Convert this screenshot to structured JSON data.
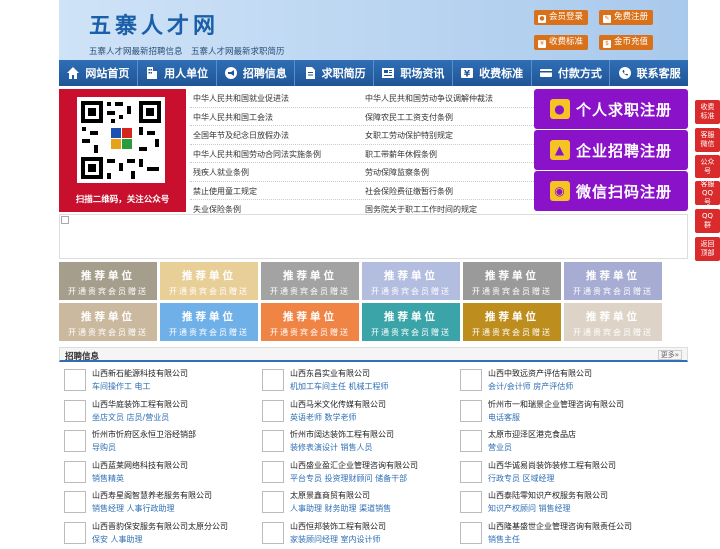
{
  "site": {
    "logo": "五寨人才网",
    "slogan": "五寨人才网最新招聘信息　五寨人才网最新求职简历"
  },
  "header_buttons": [
    {
      "label": "会员登录",
      "icon": "user-icon"
    },
    {
      "label": "免费注册",
      "icon": "edit-icon"
    },
    {
      "label": "收费标准",
      "icon": "tag-icon"
    },
    {
      "label": "金币充值",
      "icon": "coin-icon"
    }
  ],
  "nav": [
    {
      "label": "网站首页",
      "icon": "home-icon"
    },
    {
      "label": "用人单位",
      "icon": "building-icon"
    },
    {
      "label": "招聘信息",
      "icon": "megaphone-icon"
    },
    {
      "label": "求职简历",
      "icon": "document-icon"
    },
    {
      "label": "职场资讯",
      "icon": "news-icon"
    },
    {
      "label": "收费标准",
      "icon": "money-icon"
    },
    {
      "label": "付款方式",
      "icon": "card-icon"
    },
    {
      "label": "联系客服",
      "icon": "phone-icon"
    }
  ],
  "qr": {
    "caption": "扫描二维码，关注公众号"
  },
  "laws": [
    [
      "中华人民共和国就业促进法",
      "中华人民共和国劳动争议调解仲裁法"
    ],
    [
      "中华人民共和国工会法",
      "保障农民工工资支付条例"
    ],
    [
      "全国年节及纪念日放假办法",
      "女职工劳动保护特别规定"
    ],
    [
      "中华人民共和国劳动合同法实施条例",
      "职工带薪年休假条例"
    ],
    [
      "残疾人就业条例",
      "劳动保障监察条例"
    ],
    [
      "禁止使用童工规定",
      "社会保险费征缴暂行条例"
    ],
    [
      "失业保险条例",
      "国务院关于职工工作时间的规定"
    ]
  ],
  "register_buttons": [
    {
      "label": "个人求职注册",
      "icon": "person-icon"
    },
    {
      "label": "企业招聘注册",
      "icon": "company-icon"
    },
    {
      "label": "微信扫码注册",
      "icon": "wechat-icon"
    }
  ],
  "tiles": {
    "line1": "推荐单位",
    "line2": "开通贵宾会员赠送",
    "colors": [
      "#a69e8c",
      "#e8cf98",
      "#a3a3a3",
      "#b2bde0",
      "#9a9a9a",
      "#a7acd2",
      "#cbb99f",
      "#6fb0e8",
      "#ef8445",
      "#3aa4a8",
      "#bd8d1e",
      "#ddd4c7"
    ]
  },
  "jobs_section": {
    "title": "招聘信息",
    "more": "更多»"
  },
  "jobs": [
    {
      "company": "山西新石能源科技有限公司",
      "roles": "车间操作工 电工"
    },
    {
      "company": "山西东昌实业有限公司",
      "roles": "机加工车间主任 机械工程师"
    },
    {
      "company": "山西中致远资产评估有限公司",
      "roles": "会计/会计师 房产评估师"
    },
    {
      "company": "山西华庭装饰工程有限公司",
      "roles": "坐店文员 店员/营业员"
    },
    {
      "company": "山西马米文化传媒有限公司",
      "roles": "英语老师 数学老师"
    },
    {
      "company": "忻州市一和瑞景企业管理咨询有限公司",
      "roles": "电话客服"
    },
    {
      "company": "忻州市忻府区永恒卫浴经销部",
      "roles": "导购员"
    },
    {
      "company": "忻州市阔达装饰工程有限公司",
      "roles": "装修表演设计 销售人员"
    },
    {
      "company": "太原市迎泽区港克食品店",
      "roles": "营业员"
    },
    {
      "company": "山西蓝莱网络科技有限公司",
      "roles": "销售精英"
    },
    {
      "company": "山西盛业盈汇企业管理咨询有限公司",
      "roles": "平台专员 投资理财顾问 储备干部"
    },
    {
      "company": "山西华诚易尚装饰装修工程有限公司",
      "roles": "行政专员 区域经理"
    },
    {
      "company": "山西寿星阁智慧养老服务有限公司",
      "roles": "销售经理 人事行政助理"
    },
    {
      "company": "太原景鑫商贸有限公司",
      "roles": "人事助理 财务助理 渠道销售"
    },
    {
      "company": "山西泰陆零知识产权服务有限公司",
      "roles": "知识产权顾问 销售经理"
    },
    {
      "company": "山西晋豹保安服务有限公司太原分公司",
      "roles": "保安 人事助理"
    },
    {
      "company": "山西恒邦装饰工程有限公司",
      "roles": "家装顾问经理 室内设计师"
    },
    {
      "company": "山西隆基盛世企业管理咨询有限责任公司",
      "roles": "销售主任"
    }
  ],
  "side_buttons": [
    "收费标准",
    "客服微信",
    "公众号",
    "客服QQ号",
    "QQ群",
    "返回顶部"
  ]
}
